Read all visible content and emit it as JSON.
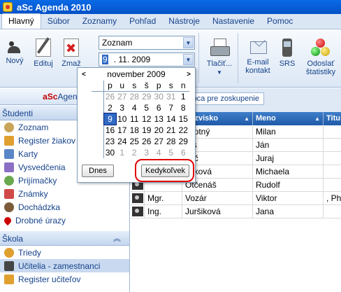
{
  "window": {
    "title": "aSc Agenda 2010"
  },
  "menu": [
    "Hlavný",
    "Súbor",
    "Zoznamy",
    "Pohľad",
    "Nástroje",
    "Nastavenie",
    "Pomoc"
  ],
  "ribbon": {
    "new_label": "Nový",
    "edit_label": "Edituj",
    "delete_label": "Zmaž",
    "view_combo": "Zoznam",
    "date_day": "9",
    "date_rest": ". 11. 2009",
    "print_label": "Tlačiť...",
    "email_label_1": "E-mail",
    "email_label_2": "kontakt",
    "sms_label": "SRS",
    "stats_label_1": "Odoslať",
    "stats_label_2": "štatistiky"
  },
  "sidebar": {
    "brand_red": "aSc",
    "brand_blue": "Agenda",
    "students_header": "Študenti",
    "students_items": [
      "Zoznam",
      "Register žiakov",
      "Karty",
      "Vysvedčenia",
      "Prijímačky",
      "Známky",
      "Dochádzka",
      "Drobné úrazy"
    ],
    "school_header": "Škola",
    "school_items": [
      "Triedy",
      "Učitelia - zamestnanci",
      "Register učiteľov"
    ]
  },
  "grid": {
    "group_hint": "meno stĺpca pre zoskupenie",
    "headers": [
      "",
      "",
      "riezvisko",
      "Meno",
      "Titu"
    ],
    "rows": [
      {
        "title": "",
        "surname": "ovotný",
        "name": "Milan",
        "extra": ""
      },
      {
        "title": "",
        "surname": "ras",
        "name": "Ján",
        "extra": ""
      },
      {
        "title": "",
        "surname": "váč",
        "name": "Juraj",
        "extra": ""
      },
      {
        "title": "",
        "surname": "yáková",
        "name": "Michaela",
        "extra": ""
      },
      {
        "title": "",
        "surname": "Otčenáš",
        "name": "Rudolf",
        "extra": ""
      },
      {
        "title": "Mgr.",
        "surname": "Vozár",
        "name": "Viktor",
        "extra": ", PhD"
      },
      {
        "title": "Ing.",
        "surname": "Juršiková",
        "name": "Jana",
        "extra": ""
      }
    ]
  },
  "calendar": {
    "month_label": "november 2009",
    "prev": "<",
    "next": ">",
    "weekdays": [
      "p",
      "u",
      "s",
      "š",
      "p",
      "s",
      "n"
    ],
    "weeks": [
      {
        "wk": "",
        "days": [
          "26",
          "27",
          "28",
          "29",
          "30",
          "31",
          "1"
        ]
      },
      {
        "wk": "",
        "days": [
          "2",
          "3",
          "4",
          "5",
          "6",
          "7",
          "8"
        ]
      },
      {
        "wk": "",
        "days": [
          "9",
          "10",
          "11",
          "12",
          "13",
          "14",
          "15"
        ]
      },
      {
        "wk": "",
        "days": [
          "16",
          "17",
          "18",
          "19",
          "20",
          "21",
          "22"
        ]
      },
      {
        "wk": "",
        "days": [
          "23",
          "24",
          "25",
          "26",
          "27",
          "28",
          "29"
        ]
      },
      {
        "wk": "",
        "days": [
          "30",
          "1",
          "2",
          "3",
          "4",
          "5",
          "6"
        ]
      }
    ],
    "today_label": "Dnes",
    "any_label": "Kedykoľvek"
  }
}
